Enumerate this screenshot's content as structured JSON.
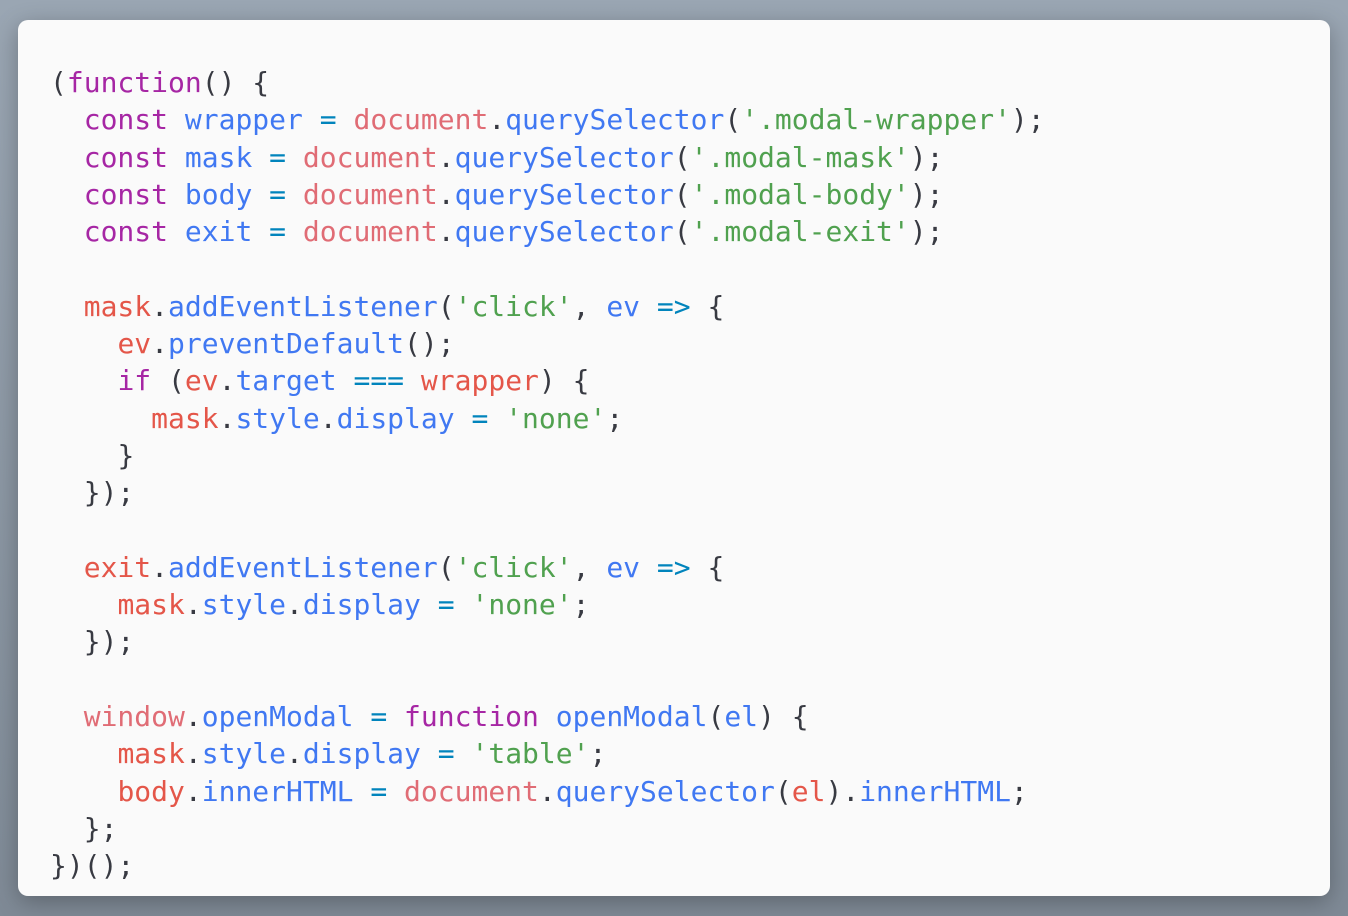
{
  "editor": {
    "lines": [
      [
        [
          "p",
          "("
        ],
        [
          "kw",
          "function"
        ],
        [
          "p",
          "() {"
        ]
      ],
      [
        [
          "ws",
          "  "
        ],
        [
          "kw",
          "const"
        ],
        [
          "ws",
          " "
        ],
        [
          "fn",
          "wrapper"
        ],
        [
          "ws",
          " "
        ],
        [
          "op",
          "="
        ],
        [
          "ws",
          " "
        ],
        [
          "glob",
          "document"
        ],
        [
          "p",
          "."
        ],
        [
          "fn",
          "querySelector"
        ],
        [
          "p",
          "("
        ],
        [
          "str",
          "'.modal-wrapper'"
        ],
        [
          "p",
          ");"
        ]
      ],
      [
        [
          "ws",
          "  "
        ],
        [
          "kw",
          "const"
        ],
        [
          "ws",
          " "
        ],
        [
          "fn",
          "mask"
        ],
        [
          "ws",
          " "
        ],
        [
          "op",
          "="
        ],
        [
          "ws",
          " "
        ],
        [
          "glob",
          "document"
        ],
        [
          "p",
          "."
        ],
        [
          "fn",
          "querySelector"
        ],
        [
          "p",
          "("
        ],
        [
          "str",
          "'.modal-mask'"
        ],
        [
          "p",
          ");"
        ]
      ],
      [
        [
          "ws",
          "  "
        ],
        [
          "kw",
          "const"
        ],
        [
          "ws",
          " "
        ],
        [
          "fn",
          "body"
        ],
        [
          "ws",
          " "
        ],
        [
          "op",
          "="
        ],
        [
          "ws",
          " "
        ],
        [
          "glob",
          "document"
        ],
        [
          "p",
          "."
        ],
        [
          "fn",
          "querySelector"
        ],
        [
          "p",
          "("
        ],
        [
          "str",
          "'.modal-body'"
        ],
        [
          "p",
          ");"
        ]
      ],
      [
        [
          "ws",
          "  "
        ],
        [
          "kw",
          "const"
        ],
        [
          "ws",
          " "
        ],
        [
          "fn",
          "exit"
        ],
        [
          "ws",
          " "
        ],
        [
          "op",
          "="
        ],
        [
          "ws",
          " "
        ],
        [
          "glob",
          "document"
        ],
        [
          "p",
          "."
        ],
        [
          "fn",
          "querySelector"
        ],
        [
          "p",
          "("
        ],
        [
          "str",
          "'.modal-exit'"
        ],
        [
          "p",
          ");"
        ]
      ],
      [],
      [
        [
          "ws",
          "  "
        ],
        [
          "var",
          "mask"
        ],
        [
          "p",
          "."
        ],
        [
          "fn",
          "addEventListener"
        ],
        [
          "p",
          "("
        ],
        [
          "str",
          "'click'"
        ],
        [
          "p",
          ", "
        ],
        [
          "fn",
          "ev"
        ],
        [
          "ws",
          " "
        ],
        [
          "op",
          "=>"
        ],
        [
          "p",
          " {"
        ]
      ],
      [
        [
          "ws",
          "    "
        ],
        [
          "var",
          "ev"
        ],
        [
          "p",
          "."
        ],
        [
          "fn",
          "preventDefault"
        ],
        [
          "p",
          "();"
        ]
      ],
      [
        [
          "ws",
          "    "
        ],
        [
          "kw",
          "if"
        ],
        [
          "p",
          " ("
        ],
        [
          "var",
          "ev"
        ],
        [
          "p",
          "."
        ],
        [
          "fn",
          "target"
        ],
        [
          "ws",
          " "
        ],
        [
          "op",
          "==="
        ],
        [
          "ws",
          " "
        ],
        [
          "var",
          "wrapper"
        ],
        [
          "p",
          ") {"
        ]
      ],
      [
        [
          "ws",
          "      "
        ],
        [
          "var",
          "mask"
        ],
        [
          "p",
          "."
        ],
        [
          "fn",
          "style"
        ],
        [
          "p",
          "."
        ],
        [
          "fn",
          "display"
        ],
        [
          "ws",
          " "
        ],
        [
          "op",
          "="
        ],
        [
          "ws",
          " "
        ],
        [
          "str",
          "'none'"
        ],
        [
          "p",
          ";"
        ]
      ],
      [
        [
          "ws",
          "    "
        ],
        [
          "p",
          "}"
        ]
      ],
      [
        [
          "ws",
          "  "
        ],
        [
          "p",
          "});"
        ]
      ],
      [],
      [
        [
          "ws",
          "  "
        ],
        [
          "var",
          "exit"
        ],
        [
          "p",
          "."
        ],
        [
          "fn",
          "addEventListener"
        ],
        [
          "p",
          "("
        ],
        [
          "str",
          "'click'"
        ],
        [
          "p",
          ", "
        ],
        [
          "fn",
          "ev"
        ],
        [
          "ws",
          " "
        ],
        [
          "op",
          "=>"
        ],
        [
          "p",
          " {"
        ]
      ],
      [
        [
          "ws",
          "    "
        ],
        [
          "var",
          "mask"
        ],
        [
          "p",
          "."
        ],
        [
          "fn",
          "style"
        ],
        [
          "p",
          "."
        ],
        [
          "fn",
          "display"
        ],
        [
          "ws",
          " "
        ],
        [
          "op",
          "="
        ],
        [
          "ws",
          " "
        ],
        [
          "str",
          "'none'"
        ],
        [
          "p",
          ";"
        ]
      ],
      [
        [
          "ws",
          "  "
        ],
        [
          "p",
          "});"
        ]
      ],
      [],
      [
        [
          "ws",
          "  "
        ],
        [
          "glob",
          "window"
        ],
        [
          "p",
          "."
        ],
        [
          "fn",
          "openModal"
        ],
        [
          "ws",
          " "
        ],
        [
          "op",
          "="
        ],
        [
          "ws",
          " "
        ],
        [
          "kw",
          "function"
        ],
        [
          "ws",
          " "
        ],
        [
          "fn",
          "openModal"
        ],
        [
          "p",
          "("
        ],
        [
          "fn",
          "el"
        ],
        [
          "p",
          ") {"
        ]
      ],
      [
        [
          "ws",
          "    "
        ],
        [
          "var",
          "mask"
        ],
        [
          "p",
          "."
        ],
        [
          "fn",
          "style"
        ],
        [
          "p",
          "."
        ],
        [
          "fn",
          "display"
        ],
        [
          "ws",
          " "
        ],
        [
          "op",
          "="
        ],
        [
          "ws",
          " "
        ],
        [
          "str",
          "'table'"
        ],
        [
          "p",
          ";"
        ]
      ],
      [
        [
          "ws",
          "    "
        ],
        [
          "var",
          "body"
        ],
        [
          "p",
          "."
        ],
        [
          "fn",
          "innerHTML"
        ],
        [
          "ws",
          " "
        ],
        [
          "op",
          "="
        ],
        [
          "ws",
          " "
        ],
        [
          "glob",
          "document"
        ],
        [
          "p",
          "."
        ],
        [
          "fn",
          "querySelector"
        ],
        [
          "p",
          "("
        ],
        [
          "var",
          "el"
        ],
        [
          "p",
          ")."
        ],
        [
          "fn",
          "innerHTML"
        ],
        [
          "p",
          ";"
        ]
      ],
      [
        [
          "ws",
          "  "
        ],
        [
          "p",
          "};"
        ]
      ],
      [
        [
          "p",
          "})();"
        ]
      ]
    ],
    "colors": {
      "background": "#fafafa",
      "keyword": "#a626a4",
      "variable": "#e45649",
      "global": "#e06c75",
      "function": "#4078f2",
      "string": "#50a14f",
      "operator": "#0184bc",
      "punctuation": "#383a42"
    }
  }
}
